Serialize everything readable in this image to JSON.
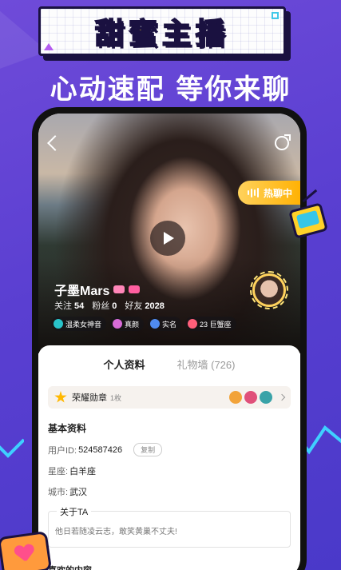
{
  "banner": {
    "title": "甜蜜主播"
  },
  "subtitle": "心动速配 等你来聊",
  "profile": {
    "hot_chip": "热聊中",
    "name": "子墨Mars",
    "stats": [
      {
        "label": "关注",
        "value": "54"
      },
      {
        "label": "粉丝",
        "value": "0"
      },
      {
        "label": "好友",
        "value": "2028"
      }
    ],
    "tags": [
      {
        "label": "温柔女神音",
        "color": "#29c3c9"
      },
      {
        "label": "真颜",
        "color": "#d86bd8"
      },
      {
        "label": "实名",
        "color": "#4f8bf0"
      },
      {
        "label": "23 巨蟹座",
        "color": "#ff5f7a"
      }
    ]
  },
  "tabs": {
    "active": "个人资料",
    "inactive": "礼物墙 (726)"
  },
  "honor": {
    "label": "荣耀勋章",
    "rank": "1枚",
    "medal_colors": [
      "#f2a33a",
      "#e0507a",
      "#3aa3a8"
    ]
  },
  "basic": {
    "title": "基本资料",
    "user_id_label": "用户ID:",
    "user_id": "524587426",
    "copy": "复制",
    "star_label": "星座:",
    "star": "白羊座",
    "city_label": "城市:",
    "city": "武汉"
  },
  "about": {
    "label": "关于TA",
    "text": "他日若随凌云志，敢笑黄巢不丈夫!"
  },
  "likes": {
    "title": "喜欢的内容"
  }
}
